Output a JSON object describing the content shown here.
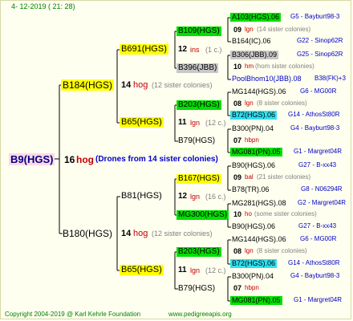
{
  "header": {
    "date": "4- 12-2019 ( 21: 28)"
  },
  "footer": {
    "copyright": "Copyright 2004-2019 @ Karl Kehrle Foundation",
    "site": "www.pedigreeapis.org"
  },
  "root": {
    "name": "B9(HGS)",
    "gen": "16",
    "code": "hog",
    "note": "(Drones from 14 sister colonies)"
  },
  "gen1": [
    {
      "name": "B184(HGS)",
      "gen": "14",
      "code": "hog",
      "note": "(12 sister colonies)"
    },
    {
      "name": "B180(HGS)",
      "gen": "14",
      "code": "hog",
      "note": "(12 sister colonies)"
    }
  ],
  "gen2": [
    {
      "name": "B691(HGS)",
      "gen": "12",
      "code": "ins",
      "note": "(1 c.)"
    },
    {
      "name": "B65(HGS)",
      "gen": "11",
      "code": "lgn",
      "note": "(12 c.)"
    },
    {
      "name": "B81(HGS)",
      "gen": "12",
      "code": "lgn",
      "note": "(16 c.)"
    },
    {
      "name": "B65(HGS)",
      "gen": "11",
      "code": "lgn",
      "note": "(12 c.)"
    }
  ],
  "gen3": [
    {
      "name": "B109(HGS)",
      "gen": "09",
      "code": "lgn",
      "note": "(14 sister colonies)"
    },
    {
      "name": "B396(JBB)",
      "gen": "10",
      "code": "hm",
      "note": "(hom sister colonies)"
    },
    {
      "name": "B203(HGS)",
      "gen": "08",
      "code": "lgn",
      "note": "(8 sister colonies)"
    },
    {
      "name": "B79(HGS)",
      "gen": "07",
      "code": "hbpn",
      "note": ""
    },
    {
      "name": "B167(HGS)",
      "gen": "09",
      "code": "bal",
      "note": "(21 sister colonies)"
    },
    {
      "name": "MG300(HGS)",
      "gen": "10",
      "code": "ho",
      "note": "(some sister colonies)"
    },
    {
      "name": "B203(HGS)",
      "gen": "08",
      "code": "lgn",
      "note": "(8 sister colonies)"
    },
    {
      "name": "B79(HGS)",
      "gen": "07",
      "code": "hbpn",
      "note": ""
    }
  ],
  "gen4": [
    {
      "name": "A103(HGS).06",
      "ref": "G5 - Bayburt98-3"
    },
    {
      "name": "B164(IC).06",
      "ref": "G22 - Sinop62R"
    },
    {
      "name": "B306(JBB).09",
      "ref": "G25 - Sinop62R"
    },
    {
      "name": "PoolBhom10(JBB).08",
      "ref": "B38(FK)+3"
    },
    {
      "name": "MG144(HGS).06",
      "ref": "G6 - MG00R"
    },
    {
      "name": "B72(HGS).06",
      "ref": "G14 - AthosSt80R"
    },
    {
      "name": "B300(PN).04",
      "ref": "G4 - Bayburt98-3"
    },
    {
      "name": "MG081(PN).05",
      "ref": "G1 - Margret04R"
    },
    {
      "name": "B90(HGS).06",
      "ref": "G27 - B-xx43"
    },
    {
      "name": "B78(TR).06",
      "ref": "G8 - N06294R"
    },
    {
      "name": "MG281(HGS).08",
      "ref": "G2 - Margret04R"
    },
    {
      "name": "B90(HGS).06",
      "ref": "G27 - B-xx43"
    },
    {
      "name": "MG144(HGS).06",
      "ref": "G6 - MG00R"
    },
    {
      "name": "B72(HGS).06",
      "ref": "G14 - AthosSt80R"
    },
    {
      "name": "B300(PN).04",
      "ref": "G4 - Bayburt98-3"
    },
    {
      "name": "MG081(PN).05",
      "ref": "G1 - Margret04R"
    }
  ]
}
